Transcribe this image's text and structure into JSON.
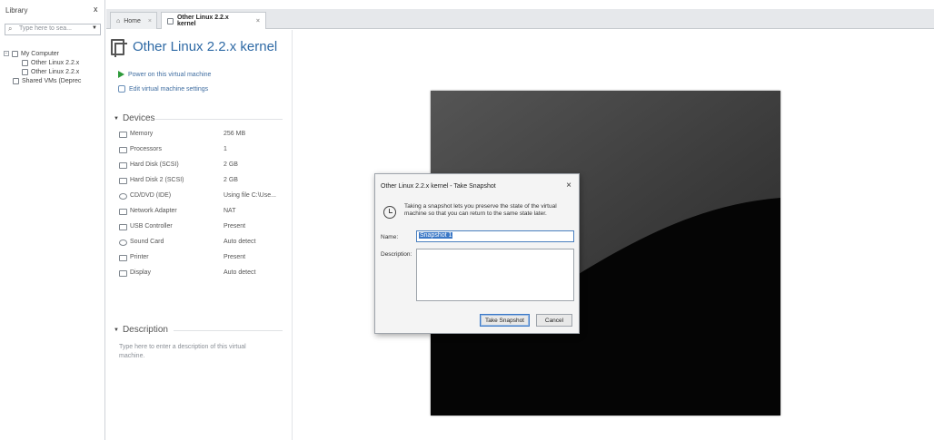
{
  "library": {
    "title": "Library",
    "close": "x",
    "search_placeholder": "Type here to sea...",
    "tree": [
      {
        "label": "My Computer"
      },
      {
        "label": "Other Linux 2.2.x"
      },
      {
        "label": "Other Linux 2.2.x"
      },
      {
        "label": "Shared VMs (Deprec"
      }
    ]
  },
  "tabs": [
    {
      "label": "Home"
    },
    {
      "label": "Other Linux 2.2.x kernel"
    }
  ],
  "vm": {
    "title": "Other Linux 2.2.x kernel",
    "actions": {
      "power_on": "Power on this virtual machine",
      "edit_settings": "Edit virtual machine settings"
    },
    "devices_header": "Devices",
    "devices": [
      {
        "name": "Memory",
        "value": "256 MB"
      },
      {
        "name": "Processors",
        "value": "1"
      },
      {
        "name": "Hard Disk (SCSI)",
        "value": "2 GB"
      },
      {
        "name": "Hard Disk 2 (SCSI)",
        "value": "2 GB"
      },
      {
        "name": "CD/DVD (IDE)",
        "value": "Using file C:\\Use..."
      },
      {
        "name": "Network Adapter",
        "value": "NAT"
      },
      {
        "name": "USB Controller",
        "value": "Present"
      },
      {
        "name": "Sound Card",
        "value": "Auto detect"
      },
      {
        "name": "Printer",
        "value": "Present"
      },
      {
        "name": "Display",
        "value": "Auto detect"
      }
    ],
    "description_header": "Description",
    "description_placeholder": "Type here to enter a description of this virtual machine."
  },
  "dialog": {
    "title": "Other Linux 2.2.x kernel - Take Snapshot",
    "close": "×",
    "info": "Taking a snapshot lets you preserve the state of the virtual machine so that you can return to the same state later.",
    "name_label": "Name:",
    "name_value": "Snapshot 1",
    "description_label": "Description:",
    "take_snapshot_button": "Take Snapshot",
    "cancel_button": "Cancel"
  },
  "colors": {
    "accent": "#2f6aa5",
    "link": "#3f6da0",
    "power": "#2e9a3a",
    "selection": "#3b78c6"
  }
}
